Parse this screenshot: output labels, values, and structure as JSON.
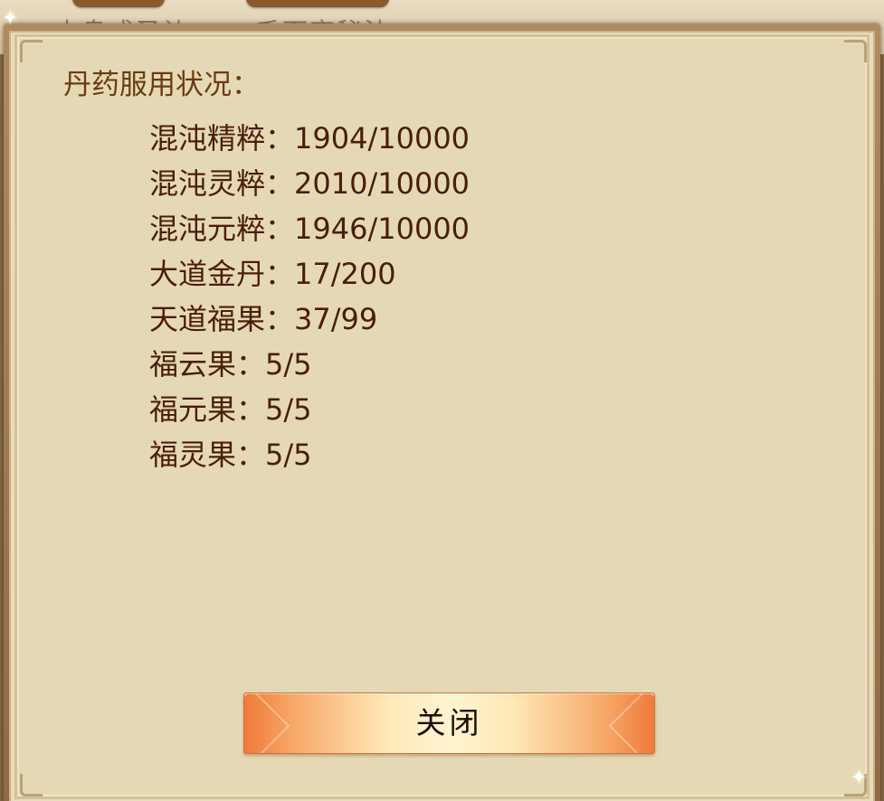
{
  "background": {
    "texts": [
      "内息成圣诀",
      "千面宗秘法"
    ]
  },
  "dialog": {
    "title": "丹药服用状况：",
    "stats": [
      {
        "label": "混沌精粹：",
        "value": "1904/10000"
      },
      {
        "label": "混沌灵粹：",
        "value": "2010/10000"
      },
      {
        "label": "混沌元粹：",
        "value": "1946/10000"
      },
      {
        "label": "大道金丹：",
        "value": "17/200"
      },
      {
        "label": "天道福果：",
        "value": "37/99"
      },
      {
        "label": "福云果：",
        "value": "5/5"
      },
      {
        "label": "福元果：",
        "value": "5/5"
      },
      {
        "label": "福灵果：",
        "value": "5/5"
      }
    ],
    "close_label": "关闭"
  },
  "colors": {
    "panel": "#e5d9b5",
    "title_text": "#6a3c10",
    "stat_text": "#4a1e08",
    "button_edge": "#f07a3a",
    "button_center": "#fff4d0"
  }
}
